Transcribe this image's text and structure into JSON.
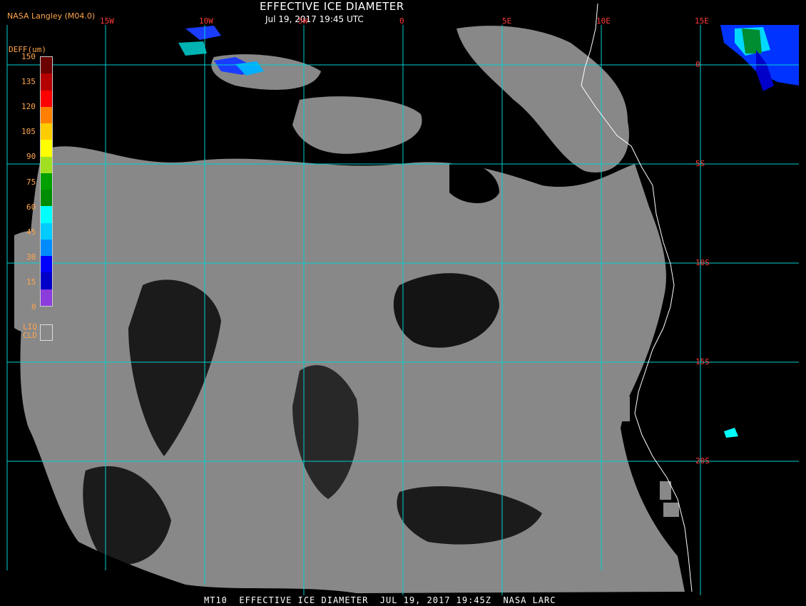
{
  "header": {
    "credit": "NASA Langley (M04.0)",
    "title": "EFFECTIVE ICE DIAMETER",
    "timestamp": "Jul 19, 2017 19:45 UTC"
  },
  "footer": {
    "caption": "MT10  EFFECTIVE ICE DIAMETER  JUL 19, 2017 19:45Z  NASA LARC"
  },
  "longitude_labels": [
    "15W",
    "10W",
    "5W",
    "0",
    "5E",
    "10E",
    "15E"
  ],
  "latitude_labels": [
    "0",
    "5S",
    "10S",
    "15S",
    "20S"
  ],
  "legend": {
    "title": "DEFF(um)",
    "ticks": [
      "150",
      "135",
      "120",
      "105",
      "90",
      "75",
      "60",
      "45",
      "30",
      "15",
      "0"
    ],
    "colors": [
      "#6b0000",
      "#b40000",
      "#ff0000",
      "#ff7f00",
      "#ffcc00",
      "#ffff00",
      "#a0e020",
      "#00a000",
      "#008c00",
      "#00ffff",
      "#00ccff",
      "#008cff",
      "#0000ff",
      "#0000c8",
      "#8c3cdc"
    ],
    "liquid_cloud_label_1": "LIQ",
    "liquid_cloud_label_2": "CLD",
    "liquid_cloud_color": "#888888"
  },
  "colors": {
    "background": "#000000",
    "grid": "#00d0d0",
    "coast": "#ffffff",
    "cloud_gray": "#888888",
    "axis_label": "#ff3b3b"
  }
}
